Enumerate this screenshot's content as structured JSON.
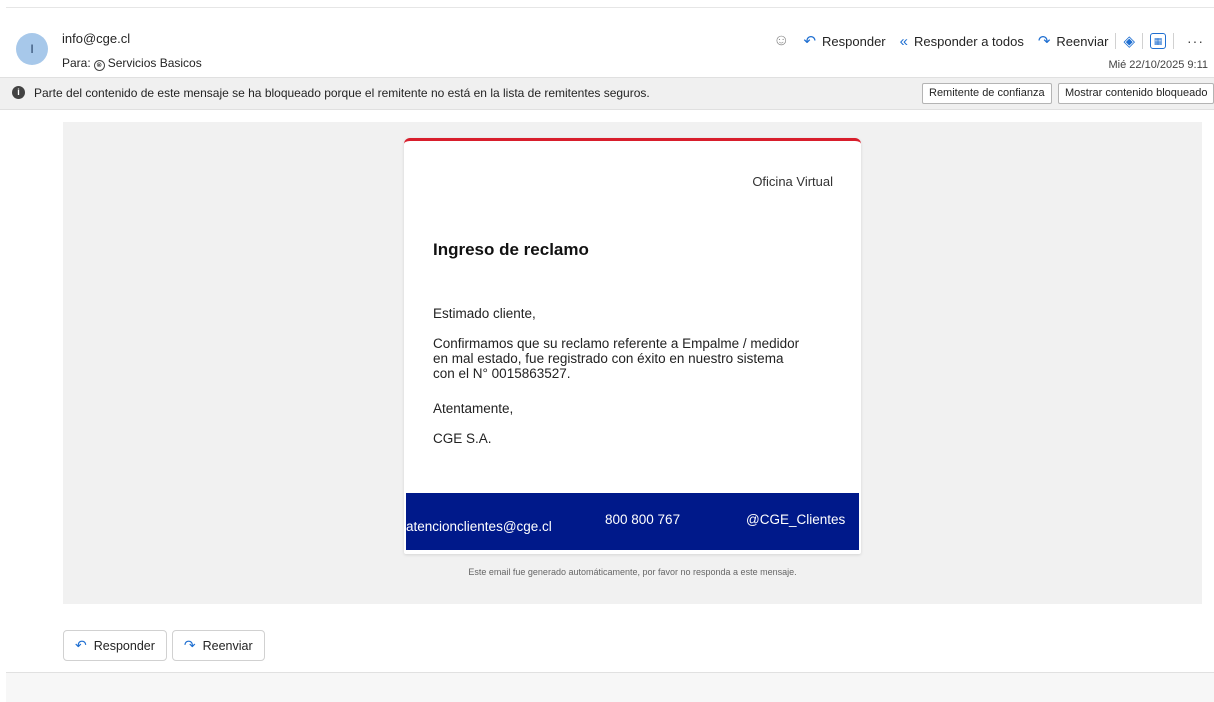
{
  "header": {
    "avatar_initial": "I",
    "from": "info@cge.cl",
    "to_label": "Para:",
    "to_recipient": "Servicios Basicos",
    "date": "Mié 22/10/2025 9:11",
    "actions": {
      "reply": "Responder",
      "reply_all": "Responder a todos",
      "forward": "Reenviar"
    }
  },
  "blocked_bar": {
    "message": "Parte del contenido de este mensaje se ha bloqueado porque el remitente no está en la lista de remitentes seguros.",
    "trust_sender": "Remitente de confianza",
    "show_blocked": "Mostrar contenido bloqueado"
  },
  "email": {
    "office": "Oficina Virtual",
    "title": "Ingreso de reclamo",
    "greeting": "Estimado cliente,",
    "body_line1": "Confirmamos que su reclamo referente a Empalme / medidor",
    "body_line2": "en mal estado, fue registrado con éxito en nuestro sistema",
    "body_line3": "con el N° 0015863527.",
    "closing": "Atentamente,",
    "signature": "CGE S.A.",
    "footer": {
      "email": "atencionclientes@cge.cl",
      "phone": "800 800 767",
      "social": "@CGE_Clientes"
    },
    "note": "Este email fue generado automáticamente, por favor no responda a este mensaje."
  },
  "bottom_buttons": {
    "reply": "Responder",
    "forward": "Reenviar"
  },
  "colors": {
    "accent_red": "#d81e2c",
    "footer_blue": "#00198a",
    "outlook_blue": "#1f6fd1"
  }
}
